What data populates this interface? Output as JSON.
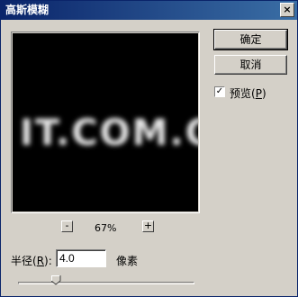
{
  "window": {
    "title": "高斯模糊",
    "close_glyph": "×"
  },
  "preview": {
    "sample_text": "IT.COM.C"
  },
  "zoom": {
    "minus": "-",
    "level": "67%",
    "plus": "+"
  },
  "buttons": {
    "ok": "确定",
    "cancel": "取消"
  },
  "preview_option": {
    "label": "预览",
    "accel": "P",
    "checked": true
  },
  "radius": {
    "label": "半径",
    "accel": "R",
    "value": "4.0",
    "units": "像素"
  },
  "slider": {
    "value_fraction": 0.2
  }
}
